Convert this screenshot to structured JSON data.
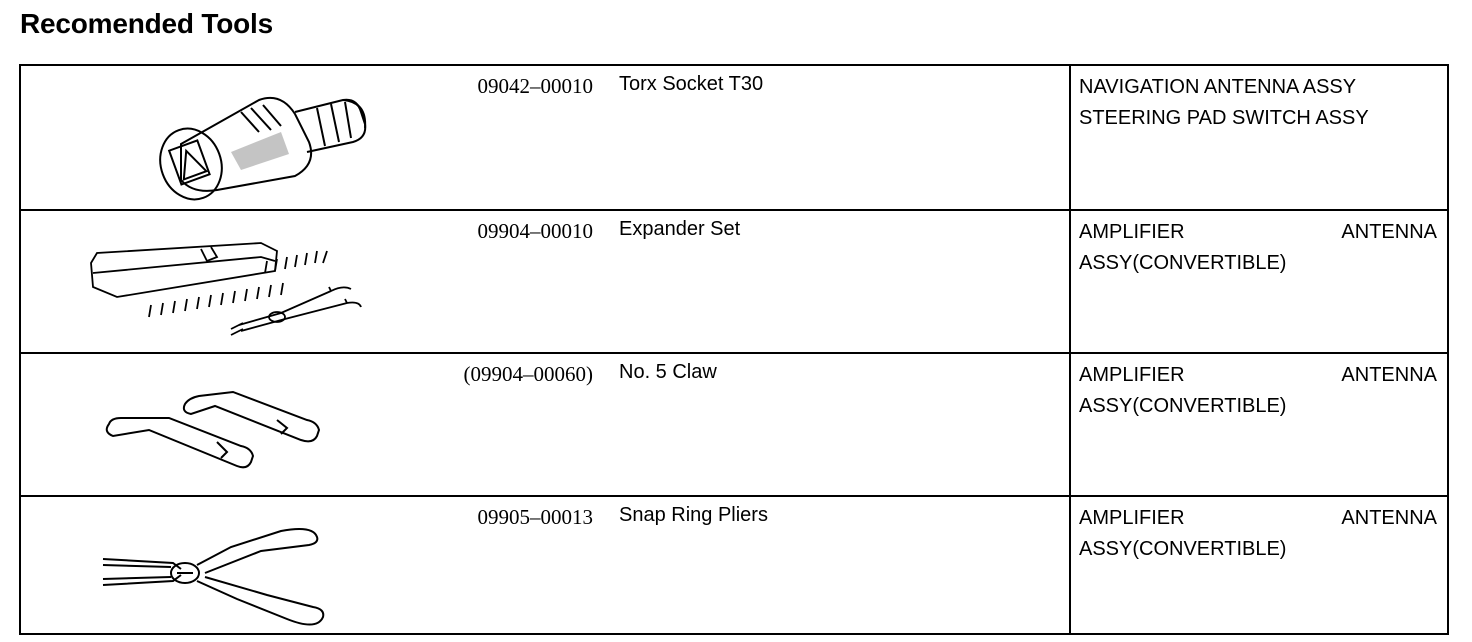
{
  "page": {
    "title": "Recomended Tools"
  },
  "tools": [
    {
      "part_no": "09042–00010",
      "name": "Torx Socket T30",
      "usage": [
        "NAVIGATION ANTENNA ASSY",
        "STEERING PAD SWITCH ASSY"
      ],
      "icon": "torx-socket-icon"
    },
    {
      "part_no": "09904–00010",
      "name": "Expander Set",
      "usage": [
        "AMPLIFIER ANTENNA",
        "ASSY(CONVERTIBLE)"
      ],
      "icon": "expander-set-icon"
    },
    {
      "part_no": "(09904–00060)",
      "name": "No. 5 Claw",
      "usage": [
        "AMPLIFIER ANTENNA",
        "ASSY(CONVERTIBLE)"
      ],
      "icon": "claw-icon"
    },
    {
      "part_no": "09905–00013",
      "name": "Snap Ring Pliers",
      "usage": [
        "AMPLIFIER ANTENNA",
        "ASSY(CONVERTIBLE)"
      ],
      "icon": "snap-ring-pliers-icon"
    }
  ]
}
